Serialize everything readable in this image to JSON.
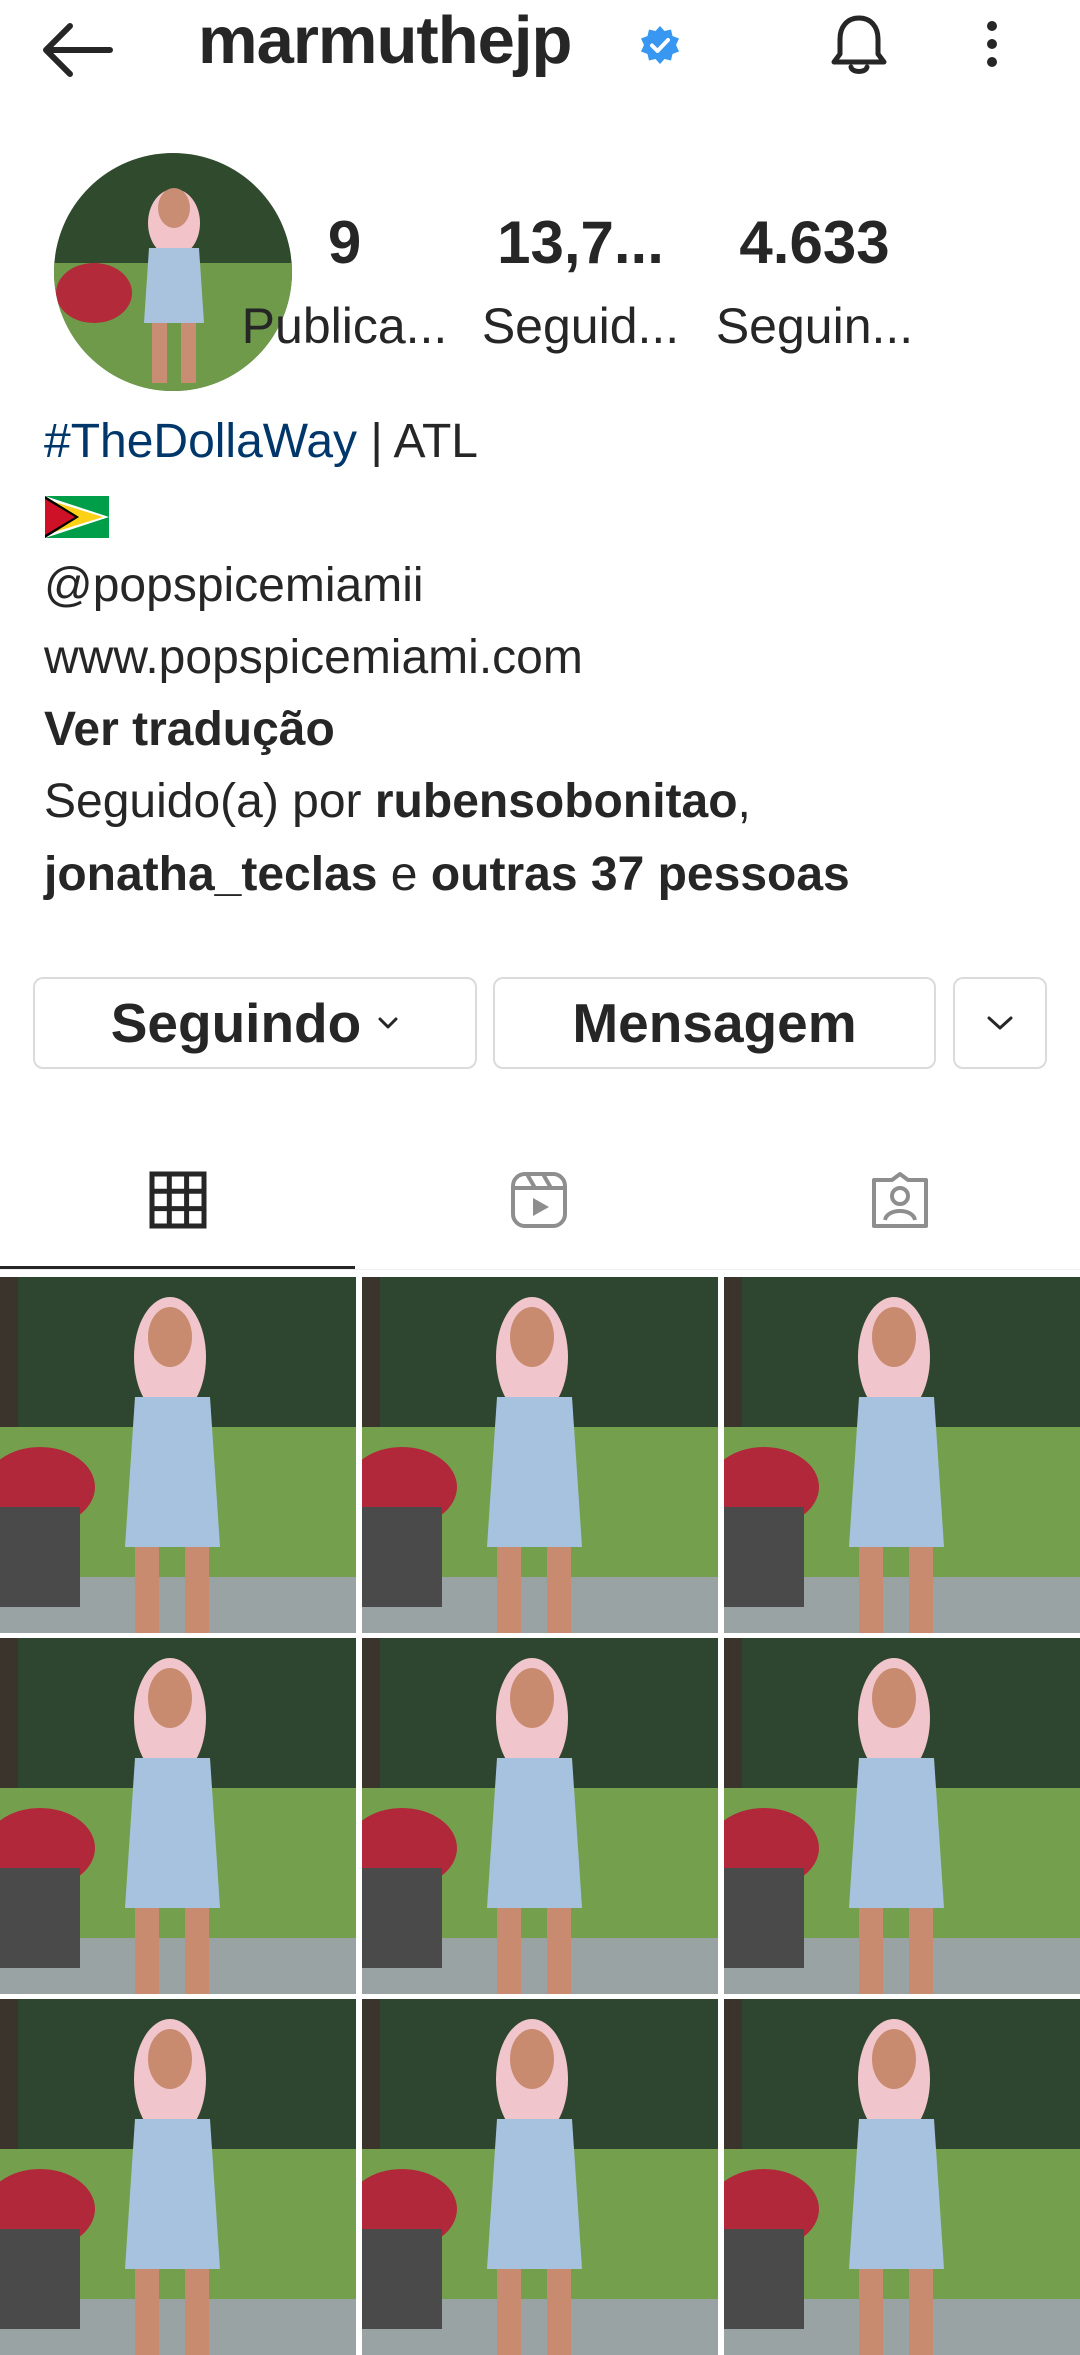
{
  "header": {
    "username": "marmuthejp",
    "back_icon": "arrow-left-icon",
    "verified_icon": "verified-badge-icon",
    "notification_icon": "bell-icon",
    "menu_icon": "more-vertical-icon"
  },
  "stats": [
    {
      "value": "9",
      "label": "Publica..."
    },
    {
      "value": "13,7...",
      "label": "Seguid..."
    },
    {
      "value": "4.633",
      "label": "Seguin..."
    }
  ],
  "bio": {
    "hashtag": "#TheDollaWay",
    "hashtag_rest": " | ATL",
    "flag": "guyana-flag",
    "mention": "@popspicemiamii",
    "website": "www.popspicemiami.com",
    "translate": "Ver tradução",
    "followed_prefix": "Seguido(a) por ",
    "followed_user1": "rubensobonitao",
    "followed_comma": ",",
    "followed_user2": "jonatha_teclas",
    "followed_and": " e ",
    "followed_others": "outras 37 pessoas"
  },
  "buttons": {
    "following_label": "Seguindo",
    "message_label": "Mensagem"
  },
  "tabs": [
    {
      "icon": "grid-icon",
      "active": true
    },
    {
      "icon": "reels-icon",
      "active": false
    },
    {
      "icon": "tagged-icon",
      "active": false
    }
  ],
  "colors": {
    "text": "#262626",
    "link": "#00376b",
    "verified": "#3897f0",
    "border": "#dbdbdb"
  }
}
